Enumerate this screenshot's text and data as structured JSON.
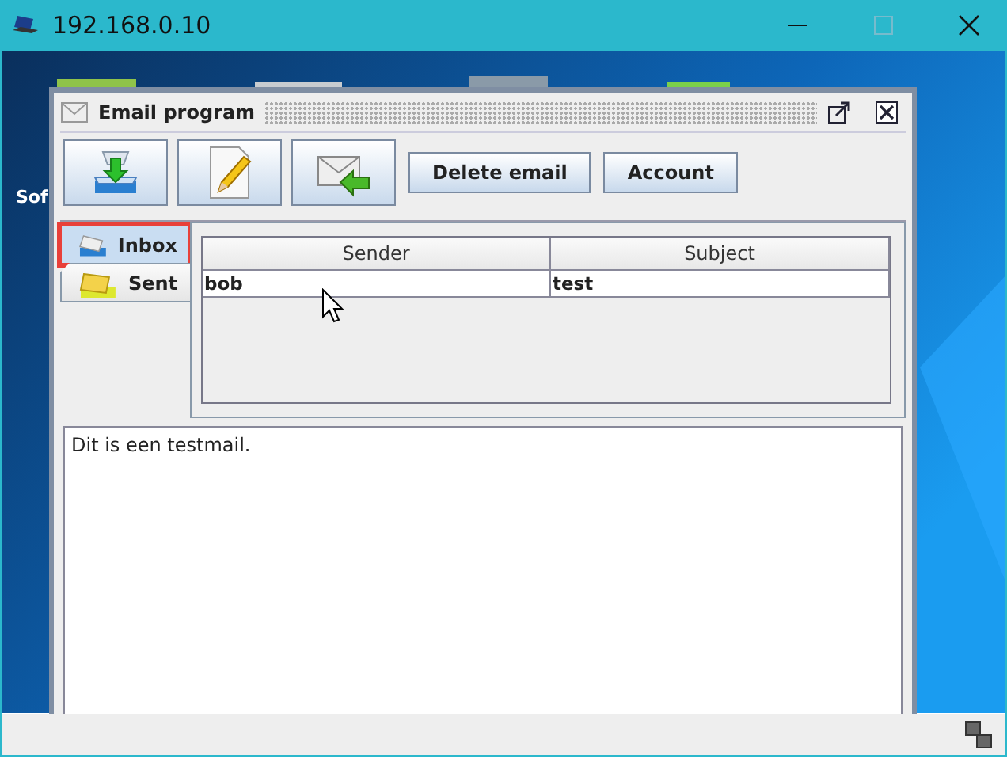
{
  "window": {
    "title": "192.168.0.10"
  },
  "desktop": {
    "icon_label": "Sof"
  },
  "frame": {
    "title": "Email program"
  },
  "toolbar": [
    {
      "kind": "icon"
    },
    {
      "kind": "icon"
    },
    {
      "kind": "icon"
    },
    {
      "kind": "text",
      "label": "Delete email"
    },
    {
      "kind": "text",
      "label": "Account"
    }
  ],
  "tabs": [
    {
      "label": "Inbox",
      "selected": true,
      "highlighted": true
    },
    {
      "label": "Sent",
      "selected": false,
      "highlighted": false
    }
  ],
  "table": {
    "columns": [
      "Sender",
      "Subject"
    ],
    "rows": [
      [
        "bob",
        "test"
      ]
    ]
  },
  "message": {
    "value": "Dit is een testmail."
  }
}
